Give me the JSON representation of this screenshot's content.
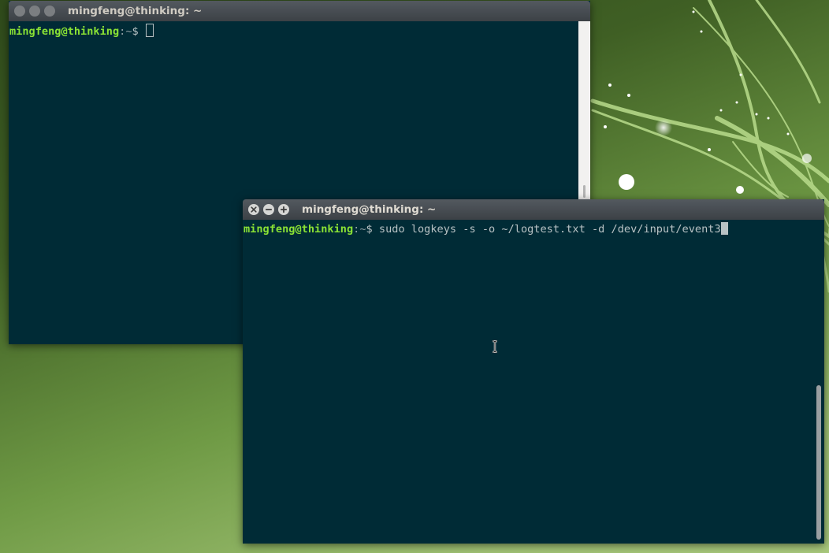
{
  "desktop": {
    "background_color": "#5a7f34"
  },
  "back_terminal": {
    "title": "mingfeng@thinking: ~",
    "prompt_user": "mingfeng@thinking",
    "prompt_sep": ":",
    "prompt_dir": "~",
    "prompt_dollar": "$ ",
    "command": "",
    "icons": [
      "close-icon",
      "minimize-icon",
      "maximize-icon"
    ]
  },
  "front_terminal": {
    "title": "mingfeng@thinking: ~",
    "prompt_user": "mingfeng@thinking",
    "prompt_sep": ":",
    "prompt_dir": "~",
    "prompt_dollar": "$ ",
    "command": "sudo logkeys -s -o ~/logtest.txt -d /dev/input/event3",
    "icons": [
      "close-icon",
      "minimize-icon",
      "maximize-icon"
    ]
  },
  "colors": {
    "terminal_bg": "#002b36",
    "prompt_user": "#8ae234",
    "text": "#b8c2c4",
    "titlebar": "#3c4146"
  }
}
